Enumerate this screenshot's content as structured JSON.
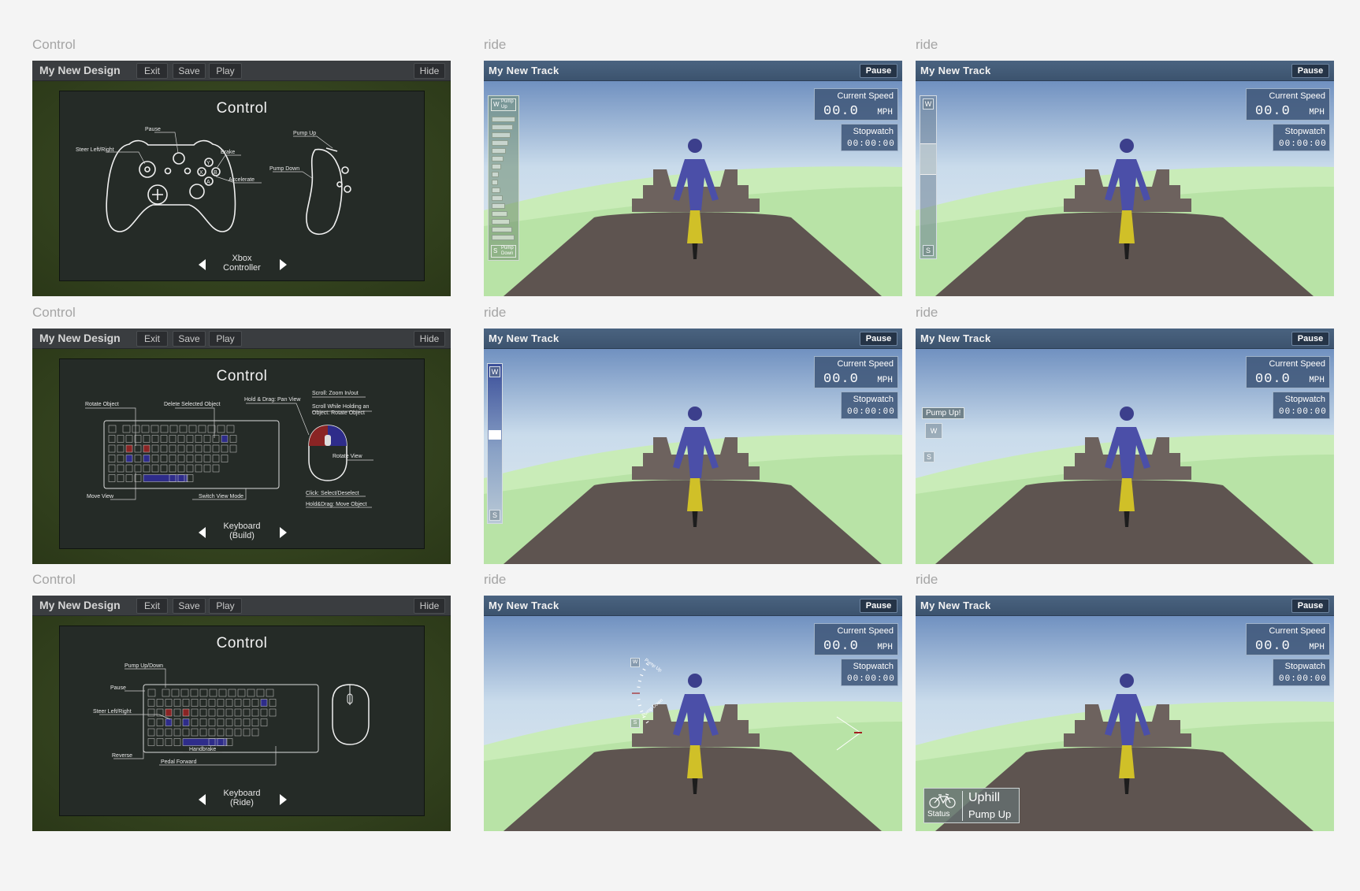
{
  "sections": {
    "control": "Control",
    "ride": "ride"
  },
  "design": {
    "title": "My New Design",
    "exit": "Exit",
    "save": "Save",
    "play": "Play",
    "hide": "Hide",
    "heading": "Control"
  },
  "controls": [
    {
      "caption_l1": "Xbox",
      "caption_l2": "Controller",
      "labels": {
        "pause": "Pause",
        "steer": "Steer Left/Right",
        "brake": "Brake",
        "accelerate": "Accelerate",
        "pump_up": "Pump Up",
        "pump_down": "Pump Down"
      }
    },
    {
      "caption_l1": "Keyboard",
      "caption_l2": "(Build)",
      "labels": {
        "rotate_object": "Rotate Object",
        "delete_selected": "Delete Selected Object",
        "pan_view": "Hold & Drag: Pan View",
        "scroll_zoom": "Scroll: Zoom In/out",
        "scroll_hold_1": "Scroll While Holding an",
        "scroll_hold_2": "Object: Rotate Object",
        "rotate_view": "Rotate View",
        "move_view": "Move View",
        "switch_view": "Switch View Mode",
        "click_select": "Click: Select/Deselect",
        "hold_drag": "Hold&Drag: Move Object"
      }
    },
    {
      "caption_l1": "Keyboard",
      "caption_l2": "(Ride)",
      "labels": {
        "pump_updown": "Pump Up/Down",
        "pause": "Pause",
        "steer": "Steer Left/Right",
        "reverse": "Reverse",
        "handbrake": "Handbrake",
        "pedal": "Pedal Forward"
      }
    }
  ],
  "ride": {
    "title": "My New Track",
    "pause": "Pause",
    "speed_label": "Current Speed",
    "speed_value": "00.0",
    "speed_unit": "MPH",
    "stopwatch_label": "Stopwatch",
    "stopwatch_value": "00:00:00"
  },
  "keys": {
    "w": "W",
    "s": "S",
    "pump_up_l1": "Pump",
    "pump_up_l2": "Up",
    "pump_down_l1": "Pump",
    "pump_down_l2": "Down",
    "pump_up_prompt": "Pump Up!",
    "arc_up": "Pump Up",
    "arc_down": "Pump Down"
  },
  "status": {
    "label": "Status",
    "line1": "Uphill",
    "line2": "Pump Up"
  }
}
